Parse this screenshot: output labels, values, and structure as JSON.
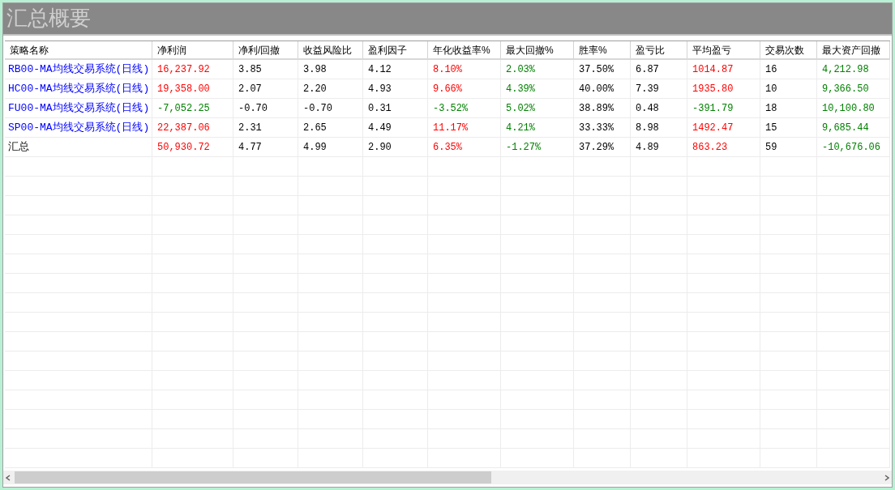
{
  "title": "汇总概要",
  "table": {
    "columns": [
      "策略名称",
      "净利润",
      "净利/回撤",
      "收益风险比",
      "盈利因子",
      "年化收益率%",
      "最大回撤%",
      "胜率%",
      "盈亏比",
      "平均盈亏",
      "交易次数",
      "最大资产回撤"
    ],
    "rows": [
      {
        "cells": [
          {
            "text": "RB00-MA均线交易系统(日线)",
            "color": "#0000ff"
          },
          {
            "text": "16,237.92",
            "color": "#ff0000"
          },
          {
            "text": "3.85"
          },
          {
            "text": "3.98"
          },
          {
            "text": "4.12"
          },
          {
            "text": "8.10%",
            "color": "#ff0000"
          },
          {
            "text": "2.03%",
            "color": "#008000"
          },
          {
            "text": "37.50%"
          },
          {
            "text": "6.87"
          },
          {
            "text": "1014.87",
            "color": "#ff0000"
          },
          {
            "text": "16"
          },
          {
            "text": "4,212.98",
            "color": "#008000"
          }
        ]
      },
      {
        "cells": [
          {
            "text": "HC00-MA均线交易系统(日线)",
            "color": "#0000ff"
          },
          {
            "text": "19,358.00",
            "color": "#ff0000"
          },
          {
            "text": "2.07"
          },
          {
            "text": "2.20"
          },
          {
            "text": "4.93"
          },
          {
            "text": "9.66%",
            "color": "#ff0000"
          },
          {
            "text": "4.39%",
            "color": "#008000"
          },
          {
            "text": "40.00%"
          },
          {
            "text": "7.39"
          },
          {
            "text": "1935.80",
            "color": "#ff0000"
          },
          {
            "text": "10"
          },
          {
            "text": "9,366.50",
            "color": "#008000"
          }
        ]
      },
      {
        "cells": [
          {
            "text": "FU00-MA均线交易系统(日线)",
            "color": "#0000ff"
          },
          {
            "text": "-7,052.25",
            "color": "#008000"
          },
          {
            "text": "-0.70"
          },
          {
            "text": "-0.70"
          },
          {
            "text": "0.31"
          },
          {
            "text": "-3.52%",
            "color": "#008000"
          },
          {
            "text": "5.02%",
            "color": "#008000"
          },
          {
            "text": "38.89%"
          },
          {
            "text": "0.48"
          },
          {
            "text": "-391.79",
            "color": "#008000"
          },
          {
            "text": "18"
          },
          {
            "text": "10,100.80",
            "color": "#008000"
          }
        ]
      },
      {
        "cells": [
          {
            "text": "SP00-MA均线交易系统(日线)",
            "color": "#0000ff"
          },
          {
            "text": "22,387.06",
            "color": "#ff0000"
          },
          {
            "text": "2.31"
          },
          {
            "text": "2.65"
          },
          {
            "text": "4.49"
          },
          {
            "text": "11.17%",
            "color": "#ff0000"
          },
          {
            "text": "4.21%",
            "color": "#008000"
          },
          {
            "text": "33.33%"
          },
          {
            "text": "8.98"
          },
          {
            "text": "1492.47",
            "color": "#ff0000"
          },
          {
            "text": "15"
          },
          {
            "text": "9,685.44",
            "color": "#008000"
          }
        ]
      },
      {
        "cells": [
          {
            "text": "汇总"
          },
          {
            "text": "50,930.72",
            "color": "#ff0000"
          },
          {
            "text": "4.77"
          },
          {
            "text": "4.99"
          },
          {
            "text": "2.90"
          },
          {
            "text": "6.35%",
            "color": "#ff0000"
          },
          {
            "text": "-1.27%",
            "color": "#008000"
          },
          {
            "text": "37.29%"
          },
          {
            "text": "4.89"
          },
          {
            "text": "863.23",
            "color": "#ff0000"
          },
          {
            "text": "59"
          },
          {
            "text": "-10,676.06",
            "color": "#008000"
          }
        ]
      }
    ]
  }
}
